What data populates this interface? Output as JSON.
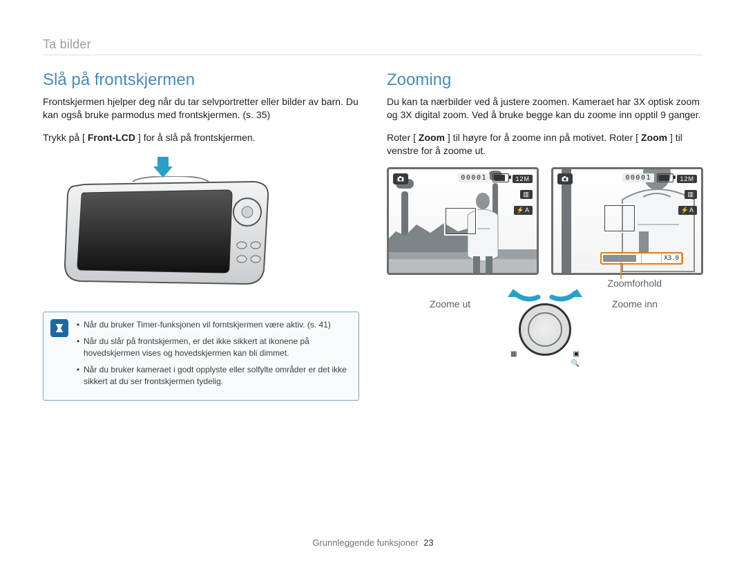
{
  "header": {
    "breadcrumb": "Ta bilder"
  },
  "left": {
    "title": "Slå på frontskjermen",
    "intro": "Frontskjermen hjelper deg når du tar selvportretter eller bilder av barn. Du kan også bruke parmodus med frontskjermen. (s. 35)",
    "instruction_pre": "Trykk på [",
    "instruction_bold": "Front-LCD",
    "instruction_post": "] for å slå på frontskjermen.",
    "notes": [
      "Når du bruker Timer-funksjonen vil forntskjermen være aktiv. (s. 41)",
      "Når du slår på frontskjermen, er det ikke sikkert at ikonene på hovedskjermen vises og hovedskjermen kan bli dimmet.",
      "Når du bruker kameraet i godt opplyste eller solfylte områder er det ikke sikkert at du ser frontskjermen tydelig."
    ]
  },
  "right": {
    "title": "Zooming",
    "intro": "Du kan ta nærbilder ved å justere zoomen. Kameraet har 3X optisk zoom og 3X digital zoom. Ved å bruke begge kan du zoome inn opptil 9 ganger.",
    "instruction_pre": "Roter [",
    "instruction_bold1": "Zoom",
    "instruction_mid": "] til høyre for å zoome inn på motivet. Roter [",
    "instruction_bold2": "Zoom",
    "instruction_post": "] til venstre for å zoome ut.",
    "lcd": {
      "counter": "00001",
      "res": "12M",
      "quality_icon": "▥",
      "flash_icon": "⚡A",
      "zoom_value": "X3.0"
    },
    "labels": {
      "ratio": "Zoomforhold",
      "out": "Zoome ut",
      "in": "Zoome inn"
    }
  },
  "footer": {
    "section": "Grunnleggende funksjoner",
    "page": "23"
  }
}
